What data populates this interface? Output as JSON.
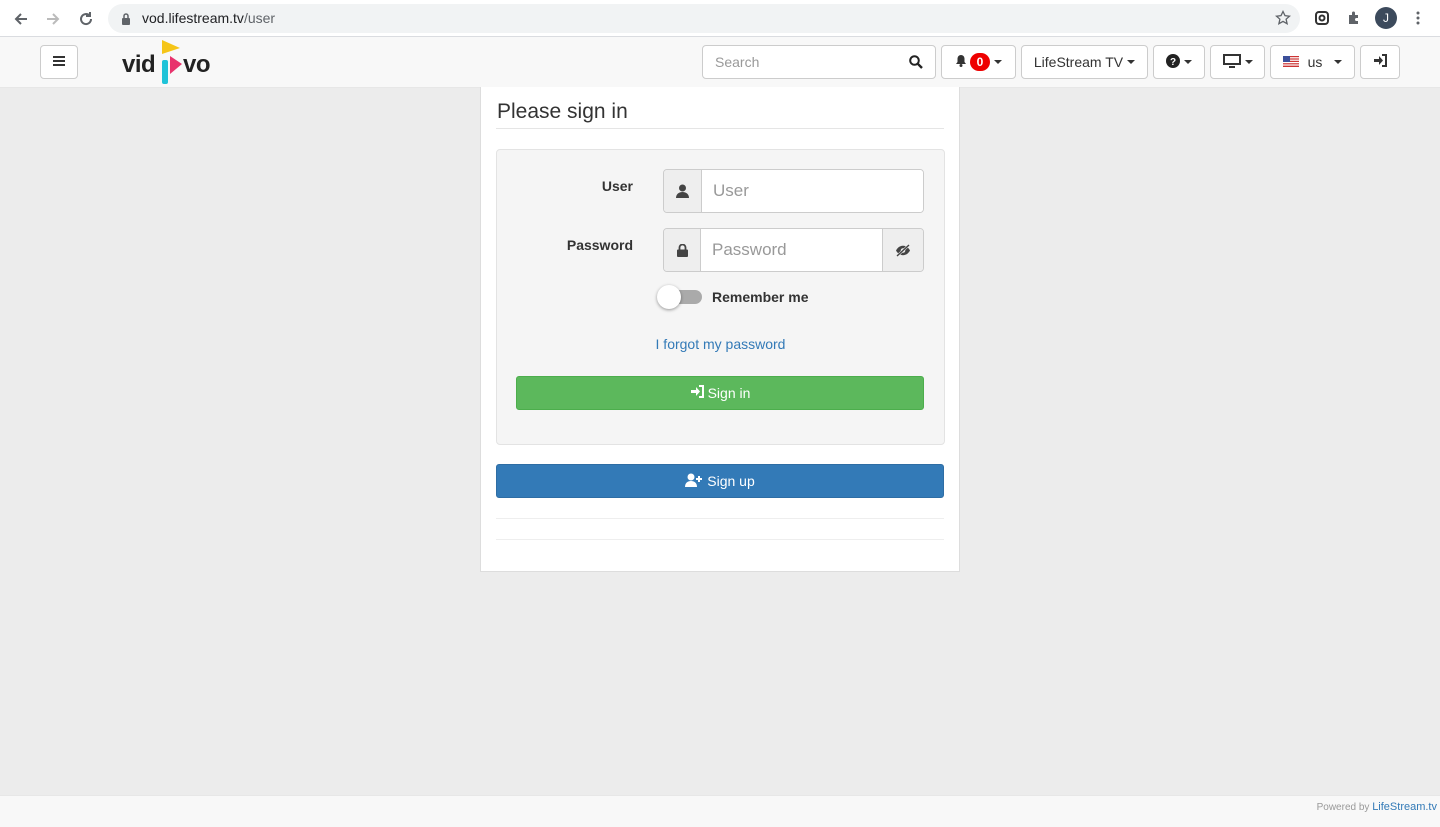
{
  "browser": {
    "url_host": "vod.lifestream.tv",
    "url_path": "/user",
    "profile_initial": "J"
  },
  "navbar": {
    "logo_left": "vid",
    "logo_right": "vo",
    "search_placeholder": "Search",
    "notifications_count": "0",
    "channel_label": "LifeStream TV",
    "language_label": "us"
  },
  "signin": {
    "title": "Please sign in",
    "user_label": "User",
    "user_placeholder": "User",
    "password_label": "Password",
    "password_placeholder": "Password",
    "remember_label": "Remember me",
    "forgot_link": "I forgot my password",
    "signin_button": "Sign in",
    "signup_button": "Sign up"
  },
  "footer": {
    "powered_by": "Powered by",
    "powered_link": "LifeStream.tv"
  },
  "colors": {
    "success": "#5cb85c",
    "primary": "#337ab7",
    "badge": "#ee0000",
    "page_bg": "#ececec"
  }
}
